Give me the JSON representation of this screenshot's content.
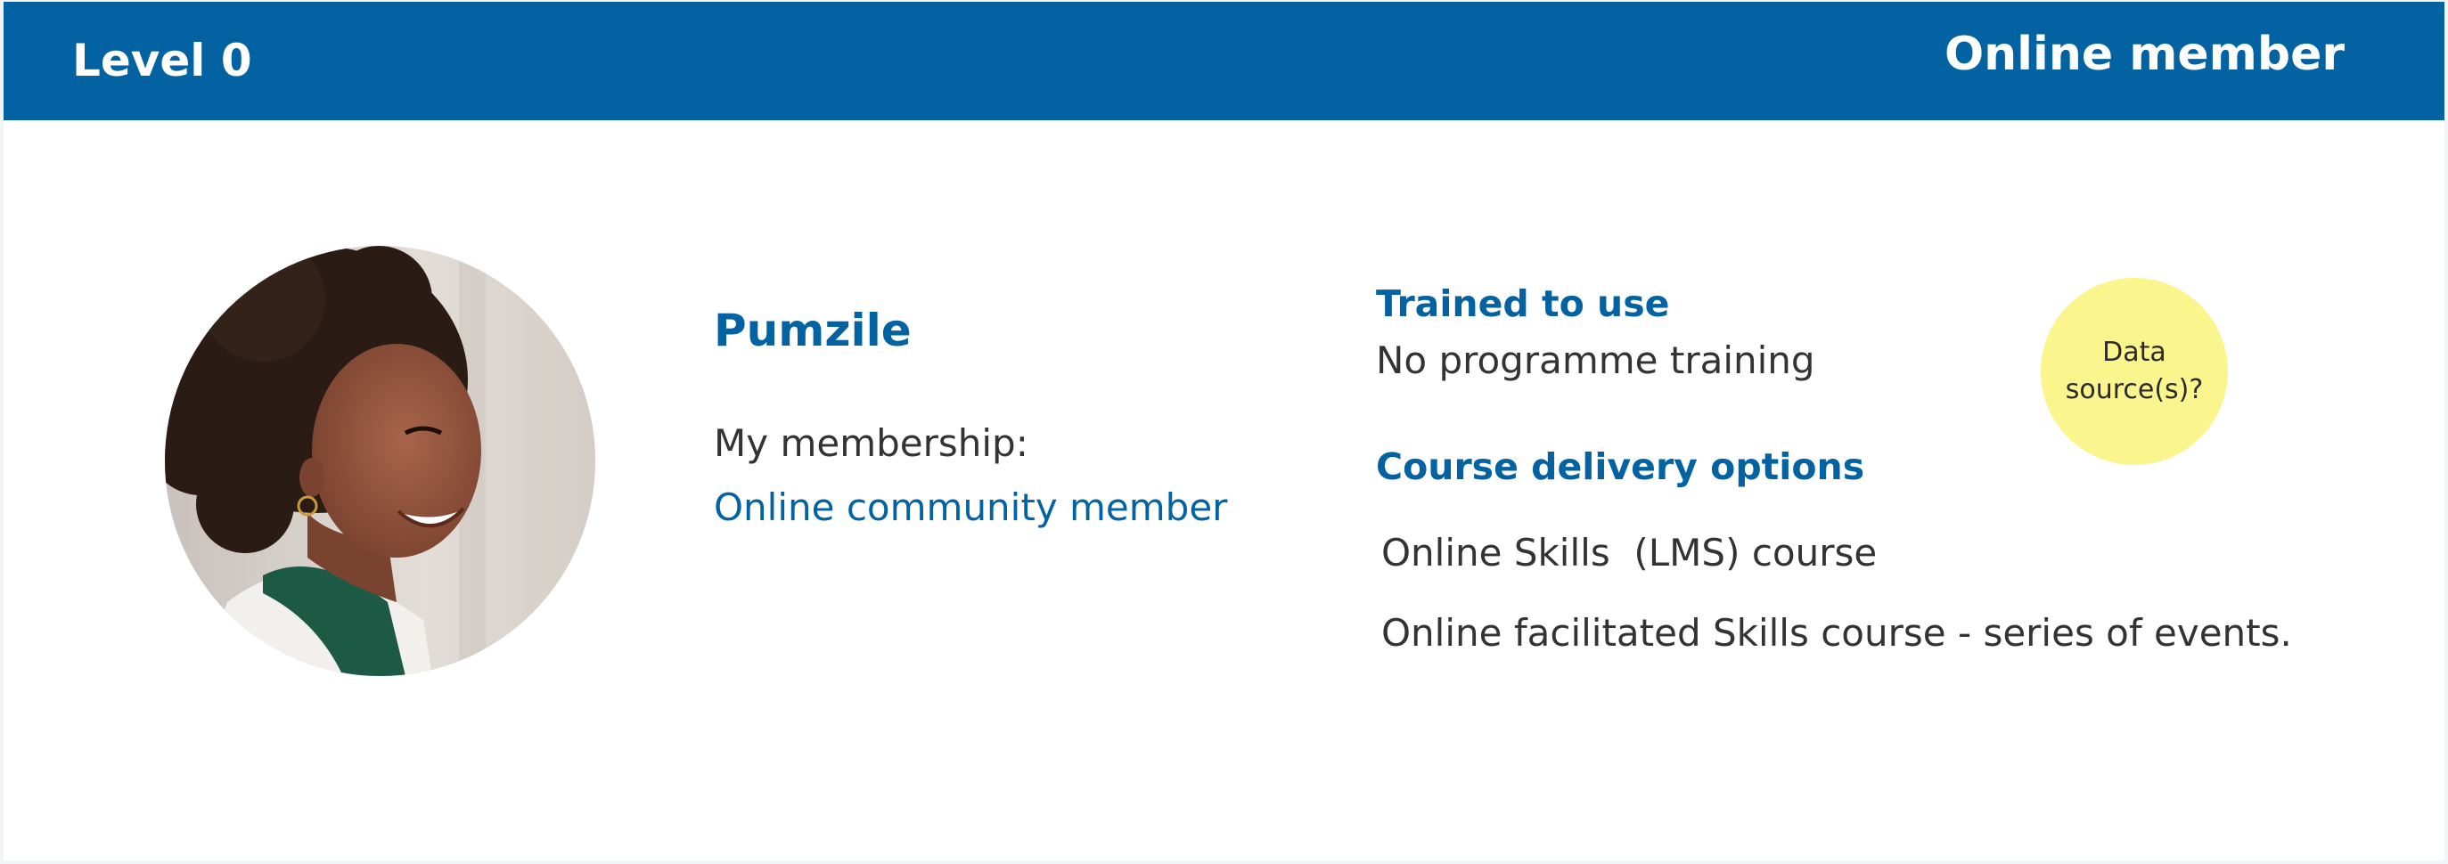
{
  "header": {
    "level": "Level 0",
    "member_type": "Online member"
  },
  "profile": {
    "name": "Pumzile",
    "membership_label": "My membership:",
    "membership_value": "Online community member"
  },
  "training": {
    "heading": "Trained to use",
    "value": "No programme training"
  },
  "delivery": {
    "heading": "Course delivery options",
    "items": [
      "Online Skills  (LMS) course",
      "Online facilitated Skills course - series of events."
    ]
  },
  "note": {
    "text": "Data source(s)?",
    "color": "#fbf58d"
  },
  "colors": {
    "brand": "#0262a2",
    "text": "#333333"
  }
}
